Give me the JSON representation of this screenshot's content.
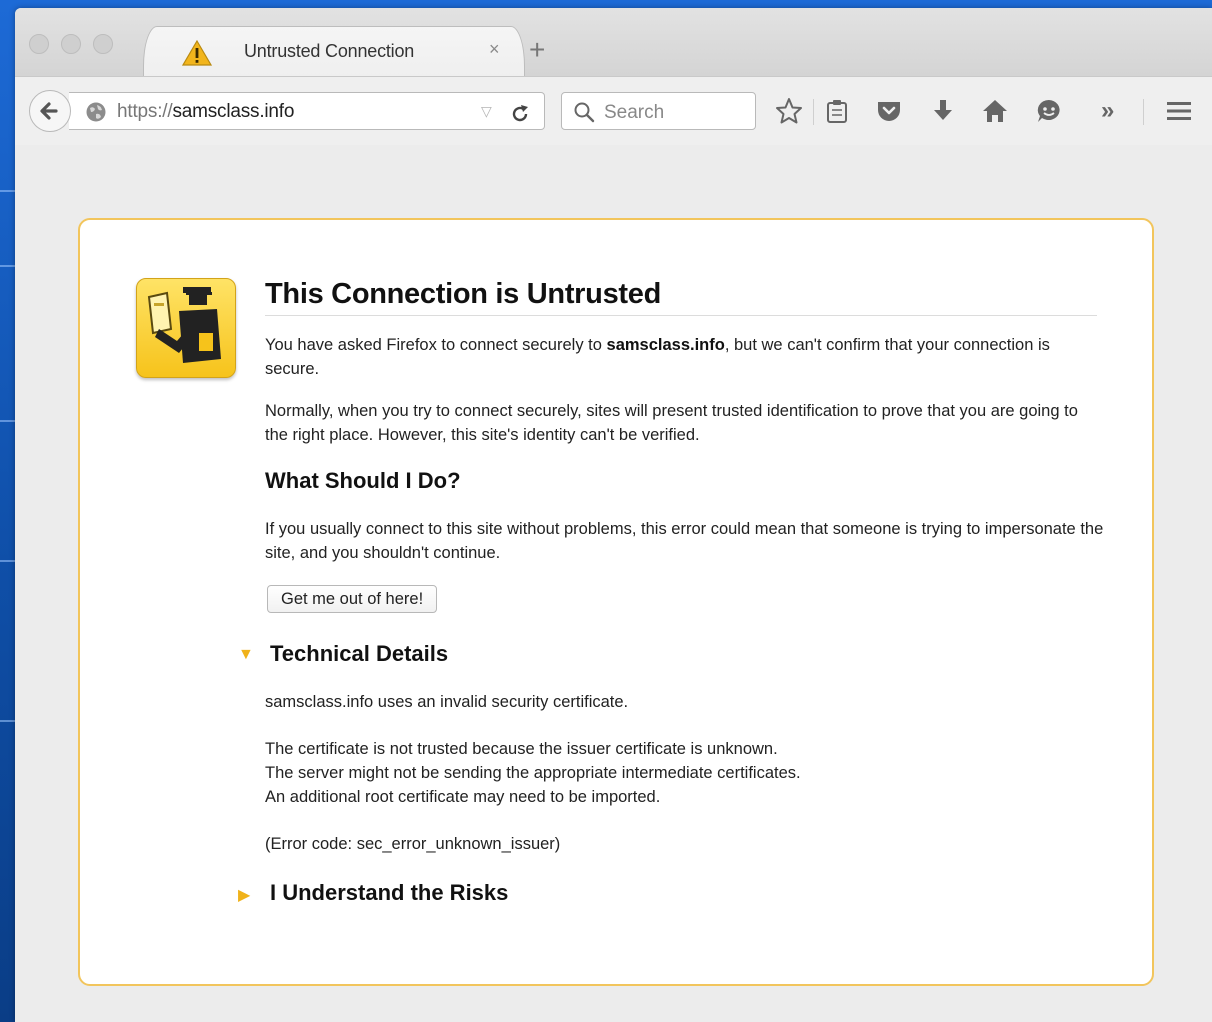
{
  "browser": {
    "tab": {
      "title": "Untrusted Connection",
      "close_label": "×"
    },
    "new_tab_label": "+",
    "url": {
      "scheme": "https://",
      "host": "samsclass.info"
    },
    "search_placeholder": "Search",
    "overflow_label": "»",
    "icons": {
      "back": "back-arrow-icon",
      "globe": "globe-icon",
      "reload": "reload-icon",
      "bookmark": "star-icon",
      "reading_list": "clipboard-icon",
      "pocket": "pocket-icon",
      "downloads": "download-icon",
      "home": "home-icon",
      "hello": "chat-icon",
      "menu": "hamburger-menu-icon"
    }
  },
  "page": {
    "title": "This Connection is Untrusted",
    "intro_before": "You have asked Firefox to connect securely to ",
    "intro_host": "samsclass.info",
    "intro_after": ", but we can't confirm that your connection is secure.",
    "normally": "Normally, when you try to connect securely, sites will present trusted identification to prove that you are going to the right place. However, this site's identity can't be verified.",
    "what_heading": "What Should I Do?",
    "what_text": "If you usually connect to this site without problems, this error could mean that someone is trying to impersonate the site, and you shouldn't continue.",
    "get_out_button": "Get me out of here!",
    "technical": {
      "heading": "Technical Details",
      "expanded": true,
      "line1": "samsclass.info uses an invalid security certificate.",
      "line2": "The certificate is not trusted because the issuer certificate is unknown.",
      "line3": "The server might not be sending the appropriate intermediate certificates.",
      "line4": "An additional root certificate may need to be imported.",
      "error_code": "(Error code: sec_error_unknown_issuer)"
    },
    "risks": {
      "heading": "I Understand the Risks",
      "expanded": false
    },
    "colors": {
      "card_border": "#f2c55c",
      "disclosure_arrow": "#f0b21a",
      "badge_yellow": "#f6c31b"
    }
  }
}
